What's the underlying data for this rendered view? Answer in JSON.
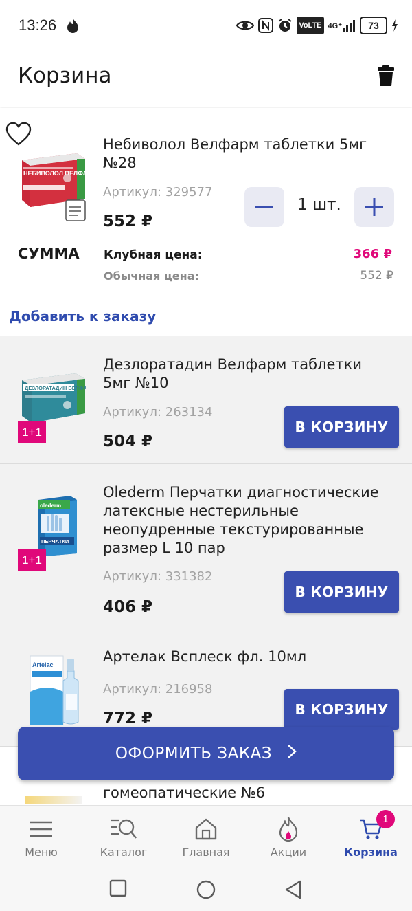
{
  "status_bar": {
    "time": "13:26",
    "network": "4G⁺",
    "volte": "VoLTE",
    "battery": "73",
    "icons": [
      "flame-icon",
      "eye-icon",
      "nfc-icon",
      "alarm-icon",
      "volte-icon",
      "signal-icon",
      "battery-icon",
      "charging-icon"
    ]
  },
  "header": {
    "title": "Корзина",
    "trash_icon": "trash-icon"
  },
  "cart_item": {
    "title": "Небиволол Велфарм таблетки 5мг №28",
    "article": "Артикул: 329577",
    "price": "552 ₽",
    "quantity": "1 шт.",
    "minus": "−",
    "plus": "+",
    "image_text": "НЕБИВОЛОЛ ВЕЛФАРМ",
    "summary_label": "СУММА",
    "club_label": "Клубная цена:",
    "club_price": "366 ₽",
    "regular_label": "Обычная цена:",
    "regular_price": "552 ₽"
  },
  "add_to_order": {
    "title": "Добавить к заказу",
    "items": [
      {
        "title": "Дезлоратадин Велфарм таблетки 5мг №10",
        "article": "Артикул: 263134",
        "price": "504 ₽",
        "badge": "1+1",
        "button": "В КОРЗИНУ",
        "image_text": "ДЕЗЛОРАТАДИН ВЕЛФАРМ"
      },
      {
        "title": "Olederm Перчатки диагностические латексные нестерильные неопудренные текстурированные размер L 10 пар",
        "article": "Артикул: 331382",
        "price": "406 ₽",
        "badge": "1+1",
        "button": "В КОРЗИНУ",
        "image_text": "ПЕРЧАТКИ"
      },
      {
        "title": "Артелак Всплеск фл. 10мл",
        "article": "Артикул: 216958",
        "price": "772 ₽",
        "button": "В КОРЗИНУ",
        "image_text": "Artelac"
      }
    ],
    "partial_title": "гомеопатические №6"
  },
  "checkout": {
    "label": "ОФОРМИТЬ ЗАКАЗ"
  },
  "bottom_nav": {
    "items": [
      {
        "label": "Меню",
        "icon": "menu-icon"
      },
      {
        "label": "Каталог",
        "icon": "catalog-search-icon"
      },
      {
        "label": "Главная",
        "icon": "home-icon"
      },
      {
        "label": "Акции",
        "icon": "promo-flame-icon"
      },
      {
        "label": "Корзина",
        "icon": "cart-icon",
        "badge": "1"
      }
    ]
  },
  "colors": {
    "accent": "#3a4fb0",
    "promo": "#e0087a"
  }
}
